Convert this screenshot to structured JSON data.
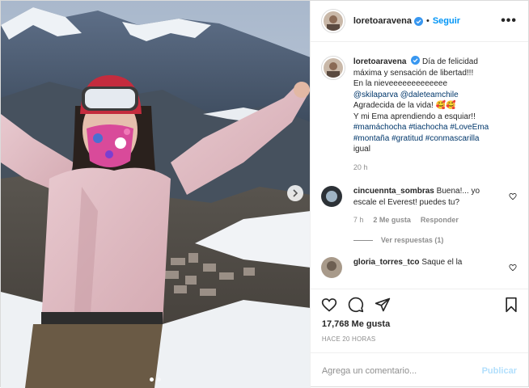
{
  "post": {
    "username": "loretoaravena",
    "follow_label": "Seguir",
    "separator": "•",
    "more_label": "•••",
    "caption": {
      "username": "loretoaravena",
      "line1": "Día de felicidad máxima y sensación de libertad!!!",
      "line2": "En la nieveeeeeeeeeeeee",
      "mention1": "@skilaparva",
      "mention2": "@daleteamchile",
      "line3": "Agradecida de la vida! 🥰🥰",
      "line4": "Y mi Ema aprendiendo a esquiar!!",
      "hashtags1": "#mamáchocha #tiachocha #LoveEma",
      "hashtags2": "#montaña #gratitud #conmascarilla",
      "line5": "igual",
      "time": "20 h"
    },
    "comments": [
      {
        "username": "cincuennta_sombras",
        "text": "Buena!... yo escale el Everest! puedes tu?",
        "time": "7 h",
        "likes": "2 Me gusta",
        "reply": "Responder",
        "view_replies": "Ver respuestas (1)"
      },
      {
        "username": "gloria_torres_tco",
        "text": "Saque el la"
      }
    ],
    "likes_count": "17,768 Me gusta",
    "posted_ago": "HACE 20 HORAS",
    "comment_placeholder": "Agrega un comentario...",
    "publish_label": "Publicar"
  },
  "carousel": {
    "total": 2,
    "active": 1
  },
  "icons": {
    "heart": "heart-icon",
    "comment": "comment-icon",
    "share": "paper-plane-icon",
    "save": "bookmark-icon",
    "verified": "verified-badge-icon",
    "next": "chevron-right-icon"
  },
  "colors": {
    "link_blue": "#0095f6",
    "hashtag": "#00376b",
    "muted": "#8e8e8e",
    "publish_disabled": "#b2dffc"
  }
}
